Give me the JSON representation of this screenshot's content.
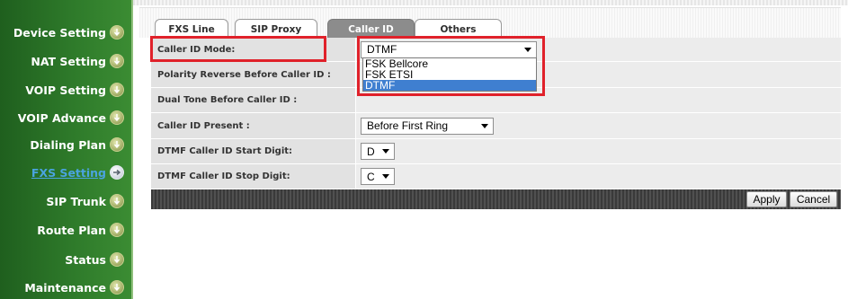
{
  "sidebar": {
    "items": [
      {
        "label": "Device Setting",
        "icon": "down-arrow-circle-icon",
        "active": false
      },
      {
        "label": "NAT Setting",
        "icon": "down-arrow-circle-icon",
        "active": false
      },
      {
        "label": "VOIP Setting",
        "icon": "down-arrow-circle-icon",
        "active": false
      },
      {
        "label": "VOIP Advance",
        "icon": "down-arrow-circle-icon",
        "active": false
      },
      {
        "label": "Dialing Plan",
        "icon": "down-arrow-circle-icon",
        "active": false
      },
      {
        "label": "FXS Setting",
        "icon": "right-arrow-circle-icon",
        "active": true
      },
      {
        "label": "SIP Trunk",
        "icon": "down-arrow-circle-icon",
        "active": false
      },
      {
        "label": "Route Plan",
        "icon": "down-arrow-circle-icon",
        "active": false
      },
      {
        "label": "Status",
        "icon": "down-arrow-circle-icon",
        "active": false
      },
      {
        "label": "Maintenance",
        "icon": "down-arrow-circle-icon",
        "active": false
      }
    ]
  },
  "tabs": [
    {
      "label": "FXS Line",
      "active": false
    },
    {
      "label": "SIP Proxy",
      "active": false
    },
    {
      "label": "Caller ID",
      "active": true
    },
    {
      "label": "Others",
      "active": false
    }
  ],
  "form": {
    "caller_id_mode": {
      "label": "Caller ID Mode:",
      "value": "DTMF"
    },
    "polarity_reverse": {
      "label": "Polarity Reverse Before Caller ID :"
    },
    "dual_tone": {
      "label": "Dual Tone Before Caller ID :"
    },
    "caller_id_present": {
      "label": "Caller ID Present :",
      "value": "Before First Ring"
    },
    "dtmf_start": {
      "label": "DTMF Caller ID Start Digit:",
      "value": "D"
    },
    "dtmf_stop": {
      "label": "DTMF Caller ID Stop Digit:",
      "value": "C"
    }
  },
  "dropdown": {
    "options": [
      "FSK Bellcore",
      "FSK ETSI",
      "DTMF"
    ],
    "selected": "DTMF"
  },
  "buttons": {
    "apply": "Apply",
    "cancel": "Cancel"
  },
  "colors": {
    "sidebar_green": "#2e7a2a",
    "active_link": "#4aa3df",
    "active_tab": "#8c8c8c",
    "highlight_red": "#e0212a",
    "selected_option": "#3f7fd0"
  }
}
